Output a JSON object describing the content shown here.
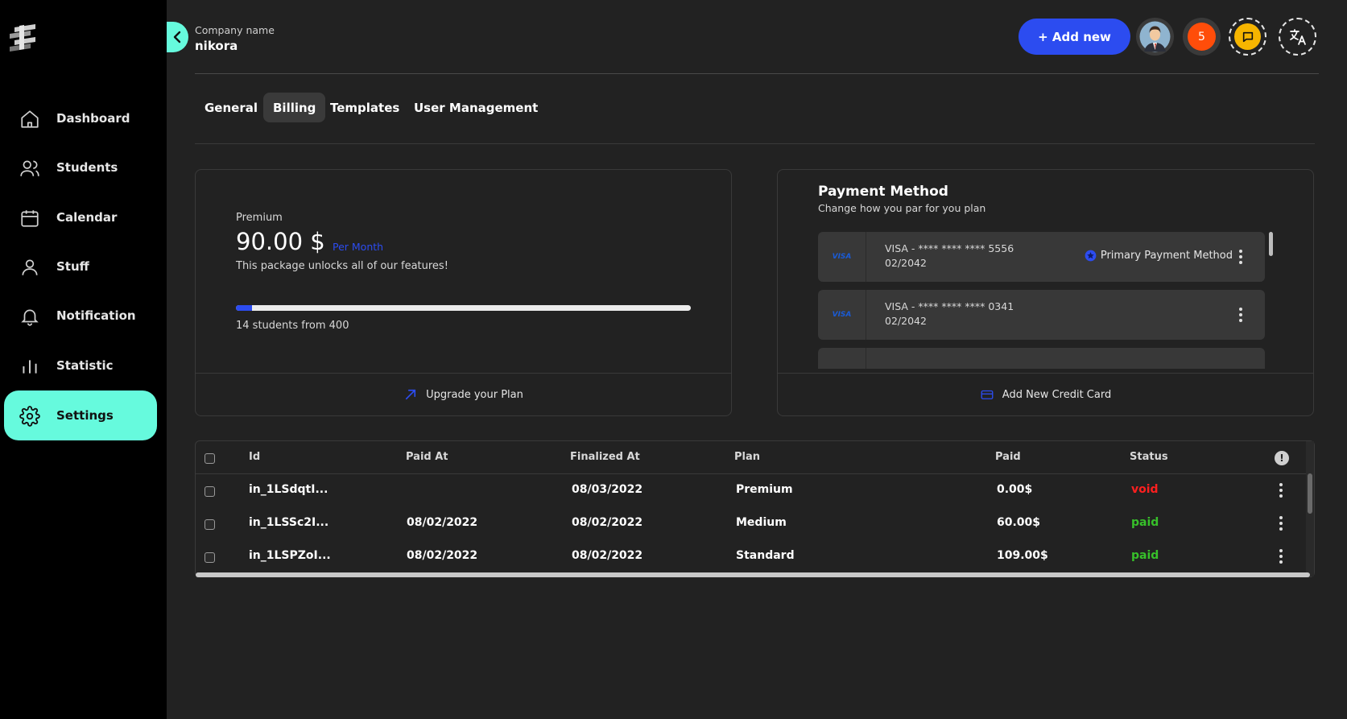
{
  "sidebar": {
    "items": [
      {
        "label": "Dashboard",
        "icon": "home-icon"
      },
      {
        "label": "Students",
        "icon": "users-icon"
      },
      {
        "label": "Calendar",
        "icon": "calendar-icon"
      },
      {
        "label": "Stuff",
        "icon": "user-icon"
      },
      {
        "label": "Notification",
        "icon": "bell-icon"
      },
      {
        "label": "Statistic",
        "icon": "bar-chart-icon"
      },
      {
        "label": "Settings",
        "icon": "gear-icon",
        "active": true
      }
    ]
  },
  "header": {
    "company_label": "Company name",
    "company_name": "nikora",
    "add_new_label": "+ Add new",
    "notification_count": "5"
  },
  "tabs": [
    {
      "label": "General"
    },
    {
      "label": "Billing",
      "active": true
    },
    {
      "label": "Templates"
    },
    {
      "label": "User Management"
    }
  ],
  "plan": {
    "name": "Premium",
    "price": "90.00 $",
    "period": "Per Month",
    "description": "This package unlocks all of our features!",
    "progress_fraction": 0.035,
    "count_text": "14 students from 400",
    "upgrade_label": "Upgrade your Plan"
  },
  "payment": {
    "title": "Payment Method",
    "subtitle": "Change how you par for you plan",
    "cards": [
      {
        "brand": "VISA",
        "number": "VISA - **** **** **** 5556",
        "expiry": "02/2042",
        "primary_label": "Primary Payment Method"
      },
      {
        "brand": "VISA",
        "number": "VISA - **** **** **** 0341",
        "expiry": "02/2042"
      }
    ],
    "add_card_label": "Add New Credit Card"
  },
  "invoices": {
    "columns": [
      "Id",
      "Paid At",
      "Finalized At",
      "Plan",
      "Paid",
      "Status"
    ],
    "rows": [
      {
        "id": "in_1LSdqtI...",
        "paid_at": "",
        "finalized_at": "08/03/2022",
        "plan": "Premium",
        "paid": "0.00$",
        "status": "void"
      },
      {
        "id": "in_1LSSc2I...",
        "paid_at": "08/02/2022",
        "finalized_at": "08/02/2022",
        "plan": "Medium",
        "paid": "60.00$",
        "status": "paid"
      },
      {
        "id": "in_1LSPZoI...",
        "paid_at": "08/02/2022",
        "finalized_at": "08/02/2022",
        "plan": "Standard",
        "paid": "109.00$",
        "status": "paid"
      }
    ]
  },
  "colors": {
    "accent": "#66fadd",
    "primary": "#2c4cf0",
    "void": "#ff1f1f",
    "paid": "#37c02a",
    "badge": "#ff4d0a",
    "chat": "#f6b500"
  }
}
